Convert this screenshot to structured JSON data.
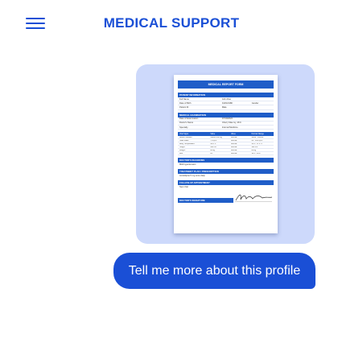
{
  "header": {
    "title": "MEDICAL SUPPORT",
    "menu_icon": "hamburger-menu-icon"
  },
  "colors": {
    "accent": "#1a4fd6",
    "bubble_bg": "#cdd9fb",
    "doc_accent": "#1f5dc8"
  },
  "document": {
    "title": "MEDICAL REPORT FORM",
    "patient": {
      "heading": "PATIENT INFORMATION",
      "rows": [
        {
          "label": "Full Name",
          "value": "John Doe"
        },
        {
          "label": "Date of Birth",
          "value": "01/01/1980",
          "extra": "Gender"
        },
        {
          "label": "Patient ID",
          "value": "Male"
        }
      ]
    },
    "exam": {
      "heading": "MEDICAL EXAMINATION",
      "rows": [
        {
          "label": "Date of Examination",
          "value": "07/10/2024"
        },
        {
          "label": "Doctor's Name",
          "value": "Cherry Mae Ivy, M.D."
        },
        {
          "label": "Specialty",
          "value": "Internal Medicine"
        }
      ]
    },
    "vitals": {
      "headers": [
        "Vital Signs",
        "Value",
        "Value",
        "Normal Range"
      ],
      "rows": [
        [
          "Blood Pressure",
          "120/80 mmHg",
          "Normal",
          "90/60 - 120/80"
        ],
        [
          "Heart Rate",
          "75 bpm",
          "Normal",
          "60 - 100 bpm"
        ],
        [
          "Body Temperature",
          "36.6°C",
          "Normal",
          "36.1 - 37.2°C"
        ],
        [
          "Height",
          "180 cm",
          "Normal",
          "180 cm"
        ],
        [
          "Weight",
          "80 kg",
          "Normal",
          "80 kg"
        ],
        [
          "BMI",
          "24",
          "Normal",
          "18.5 - 24.9"
        ]
      ]
    },
    "diagnosis": {
      "heading": "DOCTOR'S DIAGNOSIS",
      "text": "Mild hypertension"
    },
    "treatment": {
      "heading": "TREATMENT PLAN / PRESCRIPTION",
      "text": "Amlodipine 5 mg once daily"
    },
    "followup": {
      "heading": "FOLLOW-UP APPOINTMENT",
      "text": "Next Visit"
    },
    "signature": {
      "heading": "DOCTOR'S SIGNATURE"
    }
  },
  "message": {
    "text": "Tell me more about this profile"
  }
}
